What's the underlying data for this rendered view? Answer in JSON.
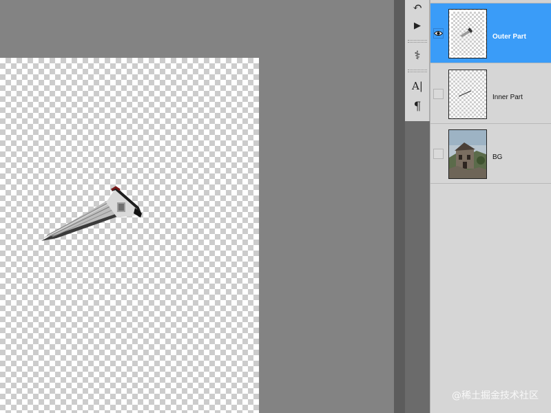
{
  "canvas": {
    "content_icon": "roof-fragment-image"
  },
  "tools": [
    {
      "name": "history-icon",
      "glyph": "↶"
    },
    {
      "name": "actions-play-icon",
      "glyph": "▶"
    },
    {
      "name": "clone-source-icon",
      "glyph": "⚕"
    },
    {
      "name": "character-icon",
      "glyph": "A|"
    },
    {
      "name": "paragraph-icon",
      "glyph": "¶"
    }
  ],
  "layers": [
    {
      "name": "Outer Part",
      "visible": true,
      "selected": true,
      "thumb": "outer-part"
    },
    {
      "name": "Inner Part",
      "visible": false,
      "selected": false,
      "thumb": "inner-part"
    },
    {
      "name": "BG",
      "visible": false,
      "selected": false,
      "thumb": "house-photo"
    }
  ],
  "watermark": "@稀土掘金技术社区",
  "colors": {
    "selection": "#3a9cf8",
    "workspace": "#838383",
    "panel": "#d6d6d6"
  }
}
